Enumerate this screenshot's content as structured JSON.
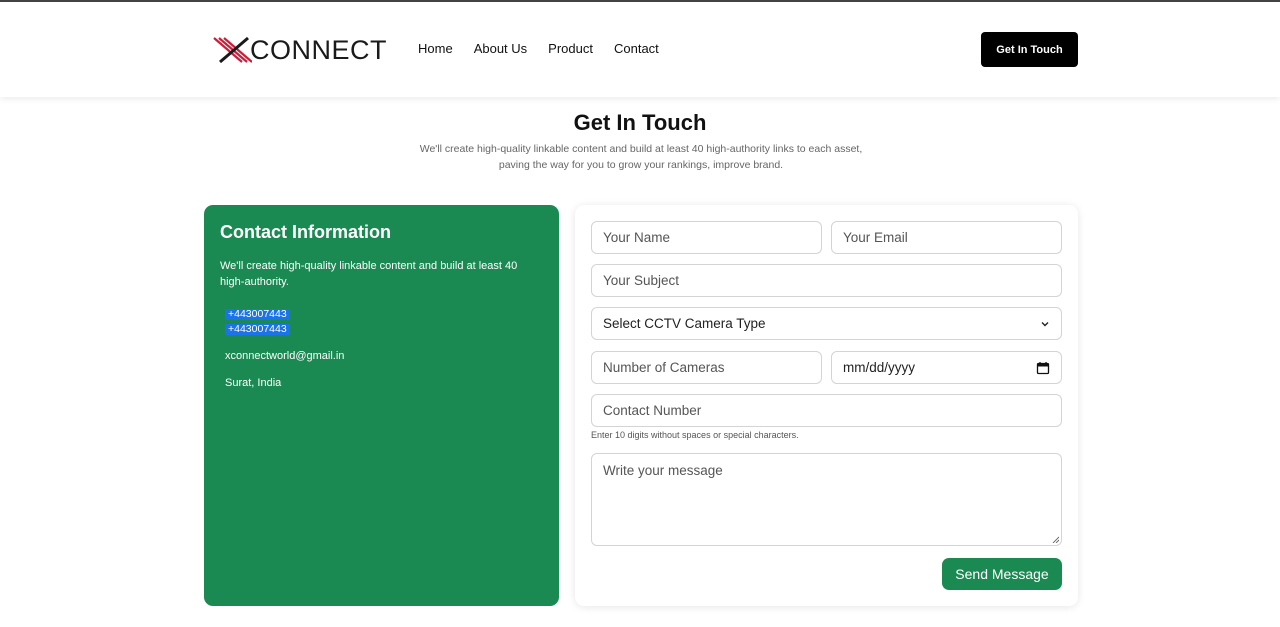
{
  "header": {
    "logo_text": "CONNECT",
    "logo_letter": "X",
    "nav": [
      "Home",
      "About Us",
      "Product",
      "Contact"
    ],
    "cta_label": "Get In Touch"
  },
  "hero": {
    "title": "Get In Touch",
    "subtitle_line1": "We'll create high-quality linkable content and build at least 40 high-authority links to each asset,",
    "subtitle_line2": "paving the way for you to grow your rankings, improve brand."
  },
  "info": {
    "title": "Contact Information",
    "description": "We'll create high-quality linkable content and build at least 40 high-authority.",
    "phone1": "+443007443",
    "phone2": "+443007443",
    "email": "xconnectworld@gmail.in",
    "location": "Surat, India",
    "card_color": "#1b8a52"
  },
  "form": {
    "name_placeholder": "Your Name",
    "email_placeholder": "Your Email",
    "subject_placeholder": "Your Subject",
    "camera_type_selected": "Select CCTV Camera Type",
    "cameras_placeholder": "Number of Cameras",
    "date_placeholder": "mm/dd/yyyy",
    "contact_placeholder": "Contact Number",
    "contact_hint": "Enter 10 digits without spaces or special characters.",
    "message_placeholder": "Write your message",
    "send_label": "Send Message"
  }
}
